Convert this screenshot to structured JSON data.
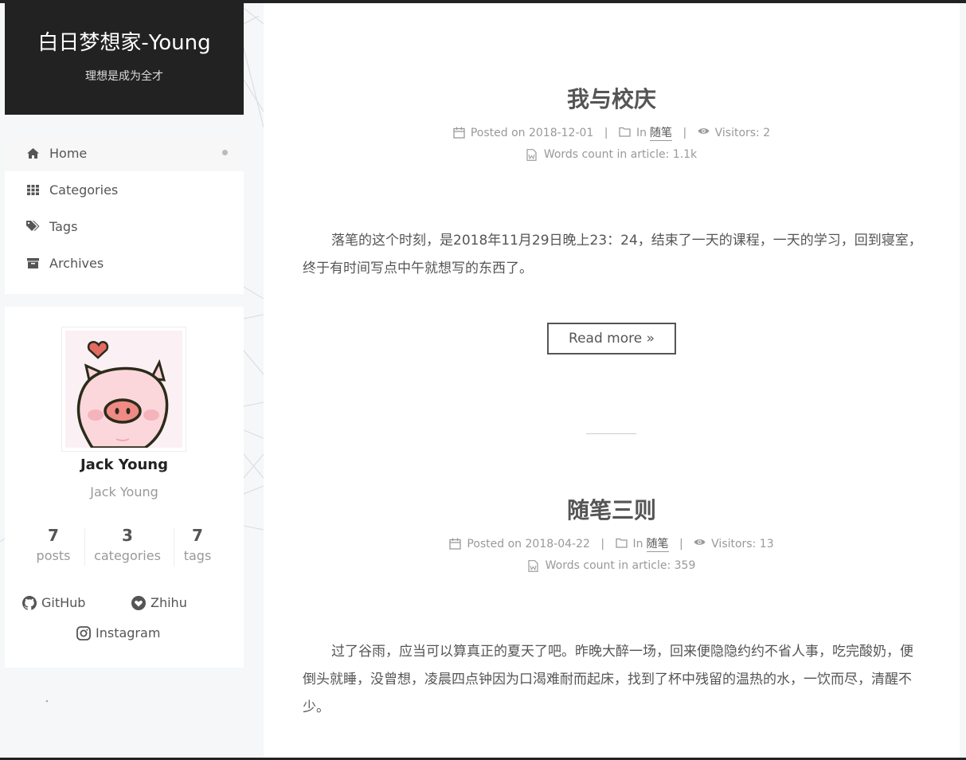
{
  "site": {
    "title": "白日梦想家-Young",
    "subtitle": "理想是成为全才"
  },
  "menu": [
    {
      "label": "Home",
      "icon": "home-icon",
      "active": true
    },
    {
      "label": "Categories",
      "icon": "th-grid-icon"
    },
    {
      "label": "Tags",
      "icon": "tags-icon"
    },
    {
      "label": "Archives",
      "icon": "archive-icon"
    }
  ],
  "profile": {
    "avatar": "pig-avatar",
    "name": "Jack Young",
    "description": "Jack Young",
    "stats": [
      {
        "count": "7",
        "label": "posts"
      },
      {
        "count": "3",
        "label": "categories"
      },
      {
        "count": "7",
        "label": "tags"
      }
    ],
    "links": [
      {
        "label": "GitHub",
        "icon": "github-icon"
      },
      {
        "label": "Zhihu",
        "icon": "heart-icon"
      },
      {
        "label": "Instagram",
        "icon": "instagram-icon"
      }
    ]
  },
  "posts": [
    {
      "title": "我与校庆",
      "posted_label": "Posted on",
      "date": "2018-12-01",
      "in_label": "In",
      "category": "随笔",
      "visitors_label": "Visitors:",
      "visitors": "2",
      "words_label": "Words count in article:",
      "words": "1.1k",
      "excerpt": "落笔的这个时刻，是2018年11月29日晚上23：24，结束了一天的课程，一天的学习，回到寝室，终于有时间写点中午就想写的东西了。",
      "read_more": "Read more »"
    },
    {
      "title": "随笔三则",
      "posted_label": "Posted on",
      "date": "2018-04-22",
      "in_label": "In",
      "category": "随笔",
      "visitors_label": "Visitors:",
      "visitors": "13",
      "words_label": "Words count in article:",
      "words": "359",
      "excerpt": "过了谷雨，应当可以算真正的夏天了吧。昨晚大醉一场，回来便隐隐约约不省人事，吃完酸奶，便倒头就睡，没曾想，凌晨四点钟因为口渴难耐而起床，找到了杯中残留的温热的水，一饮而尽，清醒不少。"
    }
  ],
  "colors": {
    "header_bg": "#222222",
    "page_bg": "#f5f7f9",
    "text": "#555555",
    "muted": "#999999"
  }
}
